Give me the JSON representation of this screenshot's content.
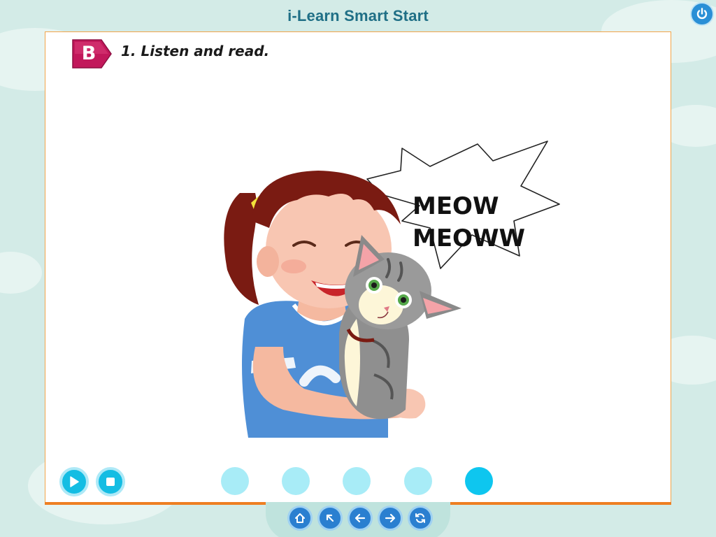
{
  "app": {
    "title": "i-Learn Smart Start"
  },
  "toolbar": {
    "power_icon": "power-icon"
  },
  "section": {
    "badge": "B",
    "instruction": "1. Listen and read."
  },
  "scene": {
    "speech_line1": "MEOW",
    "speech_line2": "MEOWW"
  },
  "audio_controls": {
    "play_icon": "play-icon",
    "stop_icon": "stop-icon"
  },
  "pagination": {
    "dots": 5,
    "active_index": 4
  },
  "bottom_nav": {
    "buttons": [
      "home-icon",
      "back-to-top-icon",
      "previous-icon",
      "next-icon",
      "refresh-icon"
    ]
  },
  "colors": {
    "accent_blue": "#14bde3",
    "badge_magenta": "#c2185b",
    "panel_border": "#f2a44a",
    "nav_blue": "#2a7fd0"
  }
}
